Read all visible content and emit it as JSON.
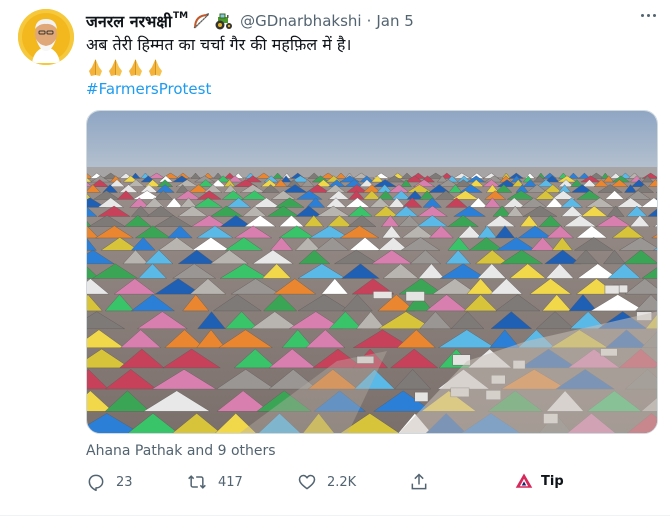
{
  "tweet": {
    "display_name": "जनरल नरभक्षी",
    "tm": "TM",
    "handle": "@GDnarbhakshi",
    "separator": "·",
    "date": "Jan 5",
    "text": "अब तेरी हिम्मत का चर्चा गैर की महफ़िल में है।",
    "emoji_row": [
      "folded-hands",
      "folded-hands",
      "folded-hands",
      "folded-hands"
    ],
    "hashtag": "#FarmersProtest",
    "name_badges": [
      "bow-and-arrow-emoji",
      "tractor-emoji"
    ]
  },
  "likers": "Ahana Pathak and 9 others",
  "actions": {
    "replies": "23",
    "retweets": "417",
    "likes": "2.2K",
    "tip": "Tip"
  },
  "colors": {
    "accent": "#1d9bf0",
    "secondary_text": "#536471",
    "primary_text": "#0f1419",
    "avatar_bg": "#f6c83b"
  },
  "icons": [
    "more-icon",
    "reply-icon",
    "retweet-icon",
    "like-icon",
    "share-icon",
    "tip-icon"
  ]
}
